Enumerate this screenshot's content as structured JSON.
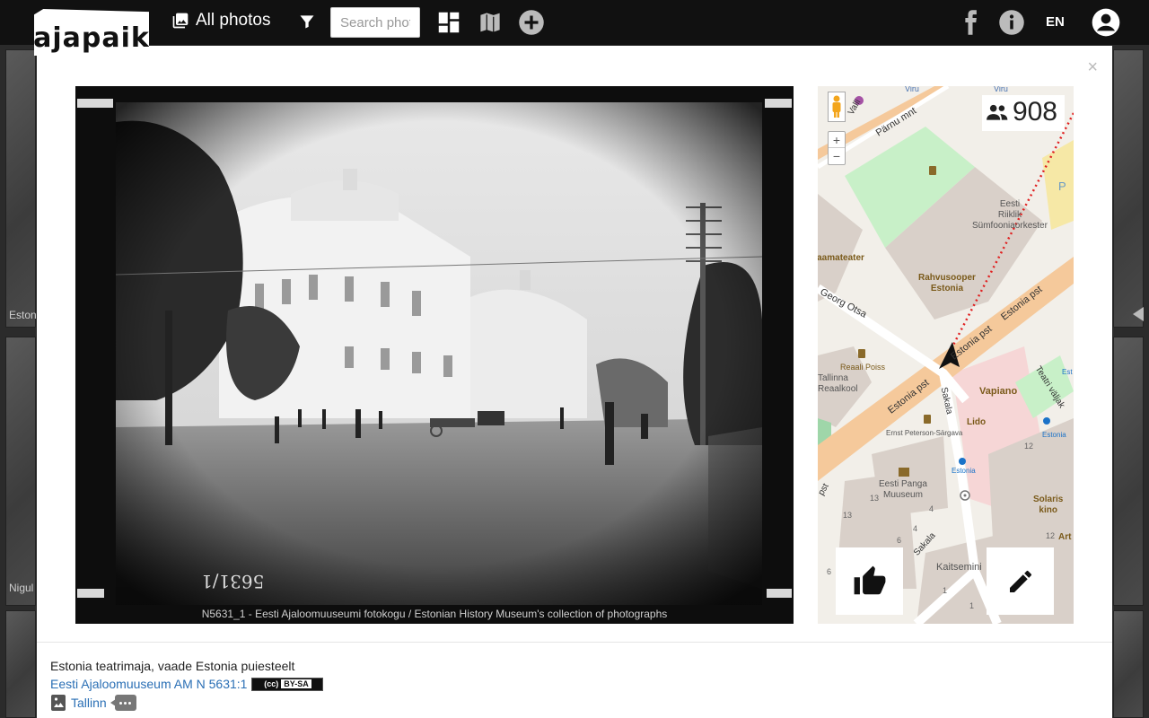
{
  "navbar": {
    "logo_text": "ajapaik",
    "all_photos_label": "All photos",
    "search_placeholder": "Search photos",
    "language": "EN"
  },
  "background": {
    "captions": [
      "Estonia",
      "Nigul"
    ]
  },
  "modal": {
    "close_label": "×",
    "photo": {
      "caption": "N5631_1  -  Eesti Ajaloomuuseumi fotokogu  /  Estonian History Museum's collection of photographs",
      "plate_number": "5631/1"
    },
    "map": {
      "viewer_count": "908",
      "zoom_in": "+",
      "zoom_out": "−",
      "labels": {
        "viru_top": "Viru",
        "valli": "Valli",
        "parnu_mnt": "Pärnu mnt",
        "viru_right": "Viru",
        "symphony": "Eesti\nRiiklik\nSümfooniaorkester",
        "p_marker": "P",
        "draamateater": "Draamateater",
        "rahvusooper": "Rahvusooper\nEstonia",
        "georg_otsa": "Georg Otsa",
        "estonia_pst_1": "Estonia pst",
        "estonia_pst_2": "Estonia pst",
        "estonia_pst_3": "Estonia pst",
        "reaali_poiss": "Reaali Poiss",
        "tallinna_reaalkool": "Tallinna\nReaalkool",
        "sakala_1": "Sakala",
        "sakala_2": "Sakala",
        "vapiano": "Vapiano",
        "teatri_valjak": "Teatri väljak",
        "lido": "Lido",
        "estonia_stop_1": "Estonia",
        "estonia_stop_2": "Estonia",
        "ernst": "Ernst Peterson-Särgava",
        "num_12a": "12",
        "num_12b": "12",
        "eesti_panga": "Eesti Panga\nMuuseum",
        "solaris": "Solaris\nkino",
        "num_13a": "13",
        "num_13b": "13",
        "num_4a": "4",
        "num_4b": "4",
        "num_6a": "6",
        "num_6b": "6",
        "num_1a": "1",
        "num_1b": "1",
        "kaitseministeerium": "Kaitsemini",
        "art": "Art",
        "est": "Est",
        "pst": "pst"
      }
    },
    "description": "Estonia teatrimaja, vaade Estonia puiesteelt",
    "source_link": "Eesti Ajaloomuuseum AM N 5631:1",
    "license": {
      "cc": "(cc)",
      "by": "BY-SA"
    },
    "place_link": "Tallinn"
  },
  "colors": {
    "navbar": "#111111",
    "link": "#2a6fb5",
    "map_road_orange": "#f5c99b",
    "map_park": "#c8f0c8",
    "map_building": "#d9d0c9"
  }
}
